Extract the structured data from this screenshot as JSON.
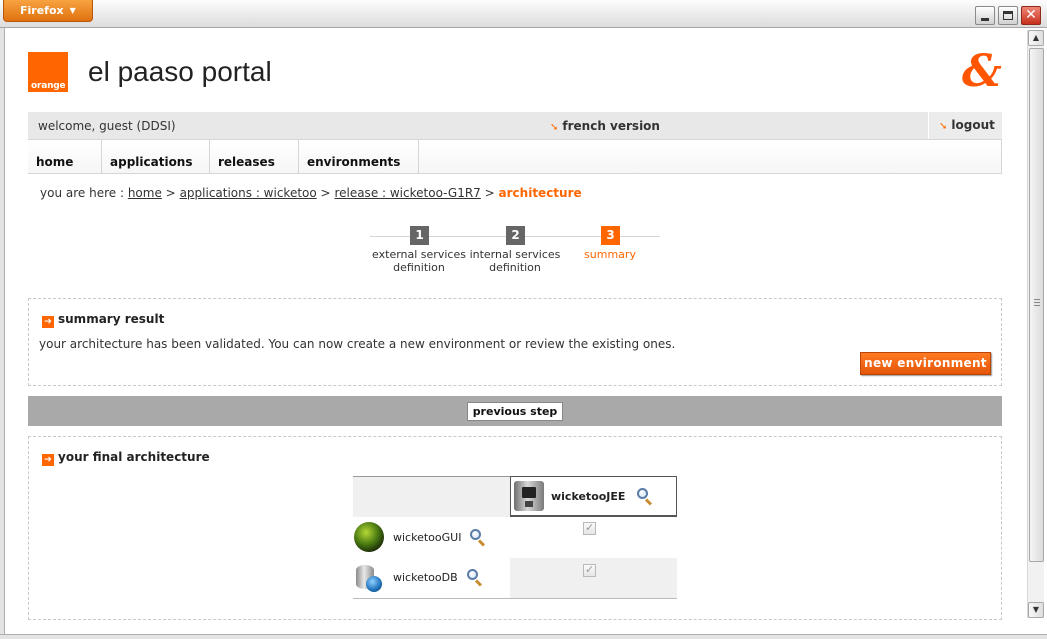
{
  "browser": {
    "menu_label": "Firefox",
    "caret": "▼",
    "close_glyph": "✕"
  },
  "header": {
    "logo_text": "orange",
    "portal_title": "el paaso portal",
    "brand_mark": "&"
  },
  "topbar": {
    "welcome": "welcome, guest (DDSI)",
    "french_version": "french version",
    "logout": "logout",
    "arrow_glyph": "➘",
    "logout_glyph": "➘"
  },
  "nav": {
    "items": [
      "home",
      "applications",
      "releases",
      "environments"
    ]
  },
  "breadcrumb": {
    "prefix": "you are here :",
    "links": [
      "home",
      "applications : wicketoo",
      "release : wicketoo-G1R7"
    ],
    "separator": ">",
    "current": "architecture"
  },
  "steps": [
    {
      "num": "1",
      "label_1": "external services",
      "label_2": "definition"
    },
    {
      "num": "2",
      "label_1": "internal services",
      "label_2": "definition"
    },
    {
      "num": "3",
      "label_1": "summary",
      "label_2": ""
    }
  ],
  "summary": {
    "title": "summary result",
    "message": "your architecture has been validated. You can now create a new environment or review the existing ones.",
    "new_env_button": "new environment",
    "arrow_glyph": "➔"
  },
  "previous_step_button": "previous step",
  "architecture": {
    "title": "your final architecture",
    "column": {
      "name": "wicketooJEE",
      "icon": "coffee-machine-icon"
    },
    "rows": [
      {
        "name": "wicketooGUI",
        "icon": "globe-icon",
        "checked": true
      },
      {
        "name": "wicketooDB",
        "icon": "database-icon",
        "checked": true
      }
    ]
  },
  "colors": {
    "accent": "#ff6600",
    "bar_gray": "#a9a9a9",
    "step_gray": "#666666"
  }
}
